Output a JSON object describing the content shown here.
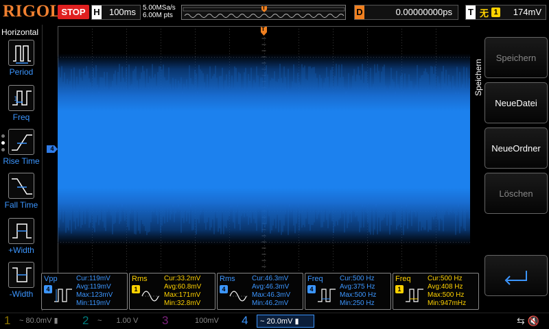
{
  "brand": "RIGOL",
  "status": {
    "run_state": "STOP"
  },
  "horizontal_bar": {
    "tag": "H",
    "timebase": "100ms"
  },
  "acquisition": {
    "sample_rate": "5.00MSa/s",
    "points": "6.00M pts"
  },
  "memory_bar": {
    "trigger_marker": "T"
  },
  "delay_bar": {
    "tag": "D",
    "value": "0.00000000ps"
  },
  "trigger_bar": {
    "tag": "T",
    "edge_icon": "rising-edge-icon",
    "source": "1",
    "level": "174mV"
  },
  "left_panel": {
    "title": "Horizontal",
    "items": [
      {
        "label": "Period",
        "icon": "period-icon"
      },
      {
        "label": "Freq",
        "icon": "frequency-icon"
      },
      {
        "label": "Rise Time",
        "icon": "rise-time-icon"
      },
      {
        "label": "Fall Time",
        "icon": "fall-time-icon"
      },
      {
        "label": "+Width",
        "icon": "positive-width-icon"
      },
      {
        "label": "-Width",
        "icon": "negative-width-icon"
      }
    ]
  },
  "waveform": {
    "channel_marker": "4",
    "trigger_position_marker": "T",
    "trace_color": "#1e90ff"
  },
  "right_menu": {
    "title": "Speichern",
    "buttons": [
      {
        "label": "Speichern",
        "state": "disabled"
      },
      {
        "label": "NeueDatei",
        "state": "enabled"
      },
      {
        "label": "NeueOrdner",
        "state": "enabled"
      },
      {
        "label": "Löschen",
        "state": "disabled"
      }
    ],
    "back_icon": "return-arrow-icon"
  },
  "measurements": [
    {
      "name": "Vpp",
      "channel": "4",
      "icon": "vpp-icon",
      "cur": "Cur:119mV",
      "avg": "Avg:119mV",
      "max": "Max:123mV",
      "min": "Min:119mV"
    },
    {
      "name": "Rms",
      "channel": "1",
      "icon": "rms-icon",
      "cur": "Cur:33.2mV",
      "avg": "Avg:60.8mV",
      "max": "Max:171mV",
      "min": "Min:32.8mV"
    },
    {
      "name": "Rms",
      "channel": "4",
      "icon": "rms-icon",
      "cur": "Cur:46.3mV",
      "avg": "Avg:46.3mV",
      "max": "Max:46.3mV",
      "min": "Min:46.2mV"
    },
    {
      "name": "Freq",
      "channel": "4",
      "icon": "frequency-icon",
      "cur": "Cur:500 Hz",
      "avg": "Avg:375 Hz",
      "max": "Max:500 Hz",
      "min": "Min:250 Hz"
    },
    {
      "name": "Freq",
      "channel": "1",
      "icon": "frequency-icon",
      "cur": "Cur:500 Hz",
      "avg": "Avg:408 Hz",
      "max": "Max:500 Hz",
      "min": "Min:947mHz"
    }
  ],
  "channels": [
    {
      "num": "1",
      "scale": "80.0mV",
      "coupling": "~",
      "color": "#ffd200",
      "state": "off"
    },
    {
      "num": "2",
      "scale": "1.00 V",
      "coupling": "~",
      "color": "#00e0e0",
      "state": "off"
    },
    {
      "num": "3",
      "scale": "100mV",
      "coupling": "",
      "color": "#e040e0",
      "state": "off"
    },
    {
      "num": "4",
      "scale": "20.0mV",
      "coupling": "~",
      "color": "#3c96ff",
      "state": "active"
    }
  ],
  "system_icons": {
    "usb": "usb-icon",
    "sound": "speaker-muted-icon"
  }
}
